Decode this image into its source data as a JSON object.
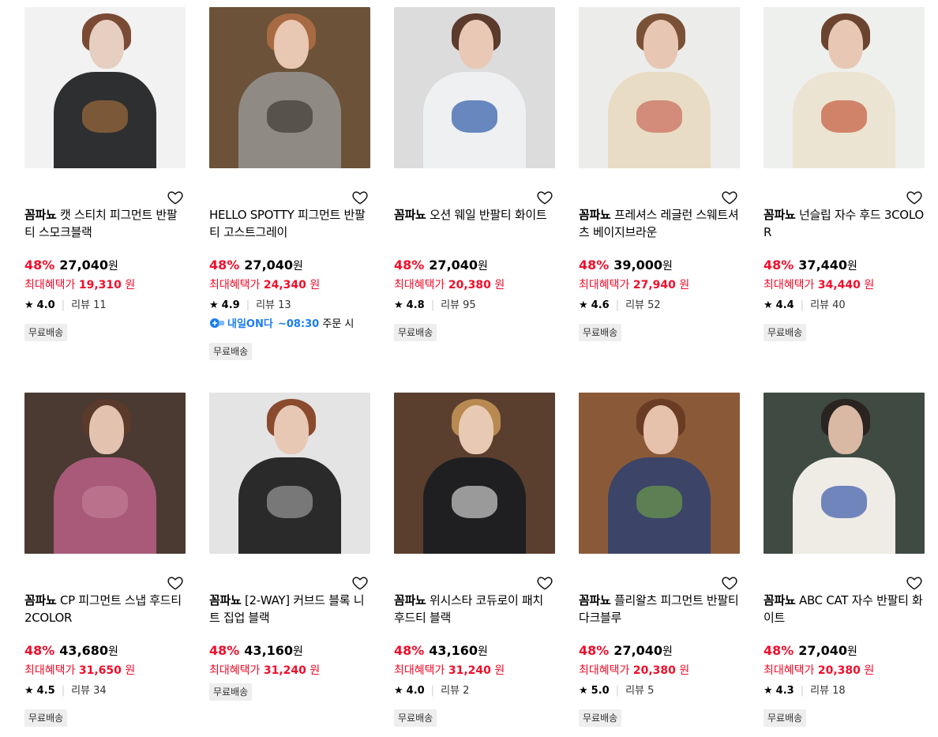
{
  "colors": {
    "discount": "#f10e2b",
    "delivery_accent": "#1b7cf2",
    "badge_bg": "#eeeeee"
  },
  "products": [
    {
      "brand": "꼼파뇨",
      "name": "캣 스티치 피그먼트 반팔티 스모크블랙",
      "discount": "48%",
      "price": "27,040",
      "won": "원",
      "benefit_label": "최대혜택가",
      "benefit_price": "19,310",
      "benefit_won": "원",
      "star_icon": "star-icon",
      "rating": "4.0",
      "review_label": "리뷰",
      "review_count": "11",
      "badge": "무료배송",
      "image_colors": [
        "#f2f2f2",
        "#2e2f31",
        "#e6cfc0",
        "#7a4a34",
        "#9c6a3a"
      ]
    },
    {
      "brand": "",
      "name": "HELLO SPOTTY 피그먼트 반팔티 고스트그레이",
      "discount": "48%",
      "price": "27,040",
      "won": "원",
      "benefit_label": "최대혜택가",
      "benefit_price": "24,340",
      "benefit_won": "원",
      "star_icon": "star-icon",
      "rating": "4.9",
      "review_label": "리뷰",
      "review_count": "13",
      "delivery_badge": "내일ON다",
      "delivery_time": "~08:30",
      "delivery_text": "주문 시",
      "badge": "무료배송",
      "image_colors": [
        "#6b5238",
        "#8f8a84",
        "#e8c7b3",
        "#a86a42",
        "#3f3a35"
      ]
    },
    {
      "brand": "꼼파뇨",
      "name": "오션 웨일 반팔티 화이트",
      "discount": "48%",
      "price": "27,040",
      "won": "원",
      "benefit_label": "최대혜택가",
      "benefit_price": "20,380",
      "benefit_won": "원",
      "star_icon": "star-icon",
      "rating": "4.8",
      "review_label": "리뷰",
      "review_count": "95",
      "badge": "무료배송",
      "image_colors": [
        "#dcdcdc",
        "#eef0f2",
        "#e9c8b6",
        "#5a3b2c",
        "#2e5aa8"
      ]
    },
    {
      "brand": "꼼파뇨",
      "name": "프레셔스 레글런 스웨트셔츠 베이지브라운",
      "discount": "48%",
      "price": "39,000",
      "won": "원",
      "benefit_label": "최대혜택가",
      "benefit_price": "27,940",
      "benefit_won": "원",
      "star_icon": "star-icon",
      "rating": "4.6",
      "review_label": "리뷰",
      "review_count": "52",
      "badge": "무료배송",
      "image_colors": [
        "#ececea",
        "#e8dcc4",
        "#e7c6b3",
        "#7a5136",
        "#c96a5a"
      ]
    },
    {
      "brand": "꼼파뇨",
      "name": "넌슬립 자수 후드 3COLOR",
      "discount": "48%",
      "price": "37,440",
      "won": "원",
      "benefit_label": "최대혜택가",
      "benefit_price": "34,440",
      "benefit_won": "원",
      "star_icon": "star-icon",
      "rating": "4.4",
      "review_label": "리뷰",
      "review_count": "40",
      "badge": "무료배송",
      "image_colors": [
        "#eef0ee",
        "#ece4d2",
        "#e8c7b4",
        "#6b4430",
        "#c65a3c"
      ]
    },
    {
      "brand": "꼼파뇨",
      "name": "CP 피그먼트 스냅 후드티 2COLOR",
      "discount": "48%",
      "price": "43,680",
      "won": "원",
      "benefit_label": "최대혜택가",
      "benefit_price": "31,650",
      "benefit_won": "원",
      "star_icon": "star-icon",
      "rating": "4.5",
      "review_label": "리뷰",
      "review_count": "34",
      "badge": "무료배송",
      "image_colors": [
        "#4a3a32",
        "#a85a78",
        "#e3c3b0",
        "#5a3a2a",
        "#c27a94"
      ]
    },
    {
      "brand": "꼼파뇨",
      "name": "[2-WAY] 커브드 블록 니트 집업 블랙",
      "discount": "48%",
      "price": "43,160",
      "won": "원",
      "benefit_label": "최대혜택가",
      "benefit_price": "31,240",
      "benefit_won": "원",
      "star_icon": "star-icon",
      "rating": "",
      "review_label": "",
      "review_count": "",
      "badge": "무료배송",
      "image_colors": [
        "#e4e4e4",
        "#2a2a2a",
        "#e6c8b5",
        "#8a4a2e",
        "#9a9a9a"
      ]
    },
    {
      "brand": "꼼파뇨",
      "name": "위시스타 코듀로이 패치 후드티 블랙",
      "discount": "48%",
      "price": "43,160",
      "won": "원",
      "benefit_label": "최대혜택가",
      "benefit_price": "31,240",
      "benefit_won": "원",
      "star_icon": "star-icon",
      "rating": "4.0",
      "review_label": "리뷰",
      "review_count": "2",
      "badge": "무료배송",
      "image_colors": [
        "#5a3e2e",
        "#1f1f22",
        "#e8c9b4",
        "#b88a52",
        "#cfcfcf"
      ]
    },
    {
      "brand": "꼼파뇨",
      "name": "플리왈츠 피그먼트 반팔티 다크블루",
      "discount": "48%",
      "price": "27,040",
      "won": "원",
      "benefit_label": "최대혜택가",
      "benefit_price": "20,380",
      "benefit_won": "원",
      "star_icon": "star-icon",
      "rating": "5.0",
      "review_label": "리뷰",
      "review_count": "5",
      "badge": "무료배송",
      "image_colors": [
        "#8a5a38",
        "#3c4468",
        "#e6c2ad",
        "#6a3c24",
        "#6a9a4a"
      ]
    },
    {
      "brand": "꼼파뇨",
      "name": "ABC CAT 자수 반팔티 화이트",
      "discount": "48%",
      "price": "27,040",
      "won": "원",
      "benefit_label": "최대혜택가",
      "benefit_price": "20,380",
      "benefit_won": "원",
      "star_icon": "star-icon",
      "rating": "4.3",
      "review_label": "리뷰",
      "review_count": "18",
      "badge": "무료배송",
      "image_colors": [
        "#3e4a42",
        "#efece6",
        "#d9b8a4",
        "#2a2420",
        "#3a5aa8"
      ]
    }
  ]
}
